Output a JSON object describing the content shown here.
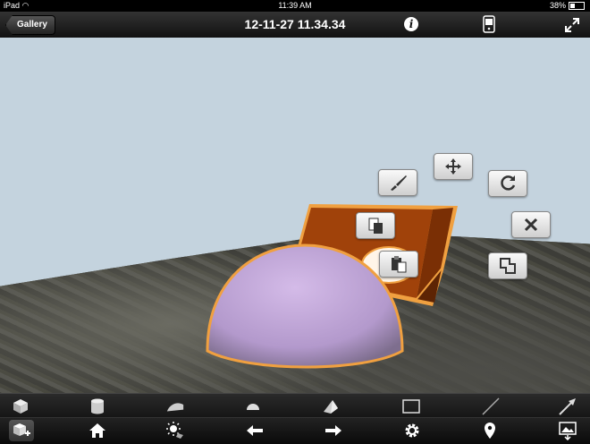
{
  "status": {
    "device": "iPad",
    "time": "11:39 AM",
    "battery": "38%",
    "battery_level": 0.38
  },
  "nav": {
    "back_label": "Gallery",
    "title": "12-11-27 11.34.34",
    "info_glyph": "i"
  },
  "scene": {
    "toolbar": [
      "paint-brush-icon",
      "move-arrows-icon",
      "rotate-icon",
      "delete-icon",
      "copy-icon",
      "paste-icon",
      "duplicate-icon"
    ],
    "objects": [
      "half-sphere",
      "triangular-prism"
    ],
    "colors": {
      "sky": "#c4d3de",
      "sphere": "#c8aedd",
      "prism": "#a0420a",
      "selection": "#f0a040"
    }
  },
  "shapes_bar": [
    "cube-icon",
    "cylinder-icon",
    "wedge-icon",
    "hemisphere-icon",
    "pyramid-icon",
    "rectangle-icon",
    "line-icon",
    "arrow-icon"
  ],
  "bottom_bar": [
    "add-object-icon",
    "home-icon",
    "sun-icon",
    "undo-icon",
    "redo-icon",
    "gear-icon",
    "location-pin-icon",
    "image-export-icon"
  ]
}
